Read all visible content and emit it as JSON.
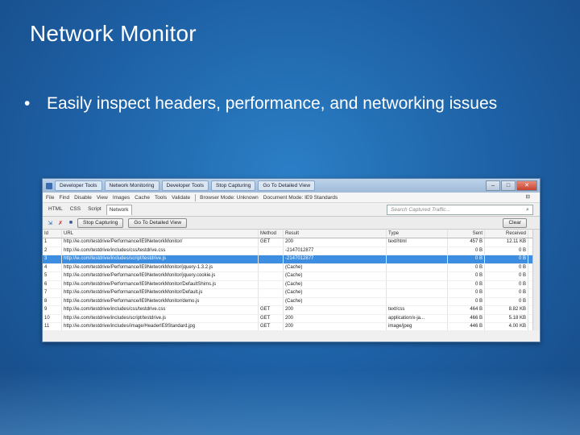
{
  "slide": {
    "title": "Network Monitor",
    "bullet": "Easily inspect headers, performance, and networking issues",
    "bullet_marker": "•"
  },
  "window": {
    "title_tabs": [
      "Developer Tools",
      "Network Monitoring",
      "Developer Tools",
      "Stop Capturing",
      "Go To Detailed View"
    ],
    "win_buttons": {
      "minimize": "–",
      "maximize": "□",
      "close": "✕"
    },
    "menu": [
      "File",
      "Find",
      "Disable",
      "View",
      "Images",
      "Cache",
      "Tools",
      "Validate"
    ],
    "menu_modes": [
      "Browser Mode: Unknown",
      "Document Mode: IE9 Standards"
    ],
    "menu_pin": "⊟",
    "tabs": [
      "HTML",
      "CSS",
      "Script",
      "Network"
    ],
    "active_tab": "Network",
    "search_placeholder": "Search Captured Traffic...",
    "search_icon": "⌕",
    "toolbar": {
      "icons": [
        "export-icon",
        "clear-cache-icon",
        "save-icon"
      ],
      "icon_glyphs": [
        "⇲",
        "✗",
        "■"
      ],
      "stop_label": "Stop Capturing",
      "detail_label": "Go To Detailed View",
      "clear_label": "Clear"
    },
    "columns": {
      "id": "Id",
      "url": "URL",
      "method": "Method",
      "result": "Result",
      "type": "Type",
      "sent": "Sent",
      "received": "Received"
    },
    "rows": [
      {
        "id": "1",
        "url": "http://ie.com/testdrive/Performance/IE9NetworkMonitor/",
        "method": "GET",
        "result": "200",
        "type": "text/html",
        "sent": "457 B",
        "received": "12.11 KB"
      },
      {
        "id": "2",
        "url": "http://ie.com/testdrive/includes/css/testdrive.css",
        "method": "",
        "result": "-2147012877",
        "type": "",
        "sent": "0 B",
        "received": "0 B"
      },
      {
        "id": "3",
        "url": "http://ie.com/testdrive/includes/script/testdrive.js",
        "method": "",
        "result": "-2147012877",
        "type": "",
        "sent": "0 B",
        "received": "0 B"
      },
      {
        "id": "4",
        "url": "http://ie.com/testdrive/Performance/IE9NetworkMonitor/jquery-1.3.2.js",
        "method": "",
        "result": "(Cache)",
        "type": "",
        "sent": "0 B",
        "received": "0 B"
      },
      {
        "id": "5",
        "url": "http://ie.com/testdrive/Performance/IE9NetworkMonitor/jquery.cookie.js",
        "method": "",
        "result": "(Cache)",
        "type": "",
        "sent": "0 B",
        "received": "0 B"
      },
      {
        "id": "6",
        "url": "http://ie.com/testdrive/Performance/IE9NetworkMonitor/DefaultShims.js",
        "method": "",
        "result": "(Cache)",
        "type": "",
        "sent": "0 B",
        "received": "0 B"
      },
      {
        "id": "7",
        "url": "http://ie.com/testdrive/Performance/IE9NetworkMonitor/Default.js",
        "method": "",
        "result": "(Cache)",
        "type": "",
        "sent": "0 B",
        "received": "0 B"
      },
      {
        "id": "8",
        "url": "http://ie.com/testdrive/Performance/IE9NetworkMonitor/demo.js",
        "method": "",
        "result": "(Cache)",
        "type": "",
        "sent": "0 B",
        "received": "0 B"
      },
      {
        "id": "9",
        "url": "http://ie.com/testdrive/includes/css/testdrive.css",
        "method": "GET",
        "result": "200",
        "type": "text/css",
        "sent": "464 B",
        "received": "8.82 KB"
      },
      {
        "id": "10",
        "url": "http://ie.com/testdrive/includes/script/testdrive.js",
        "method": "GET",
        "result": "200",
        "type": "application/x-ja...",
        "sent": "466 B",
        "received": "5.18 KB"
      },
      {
        "id": "11",
        "url": "http://ie.com/testdrive/includes/image/HeaderIE9Standard.jpg",
        "method": "GET",
        "result": "200",
        "type": "image/jpeg",
        "sent": "446 B",
        "received": "4.00 KB"
      }
    ],
    "selected_row": 3
  },
  "colors": {
    "selection": "#3d8ee0",
    "slide_bg": "#1d5fa3"
  }
}
